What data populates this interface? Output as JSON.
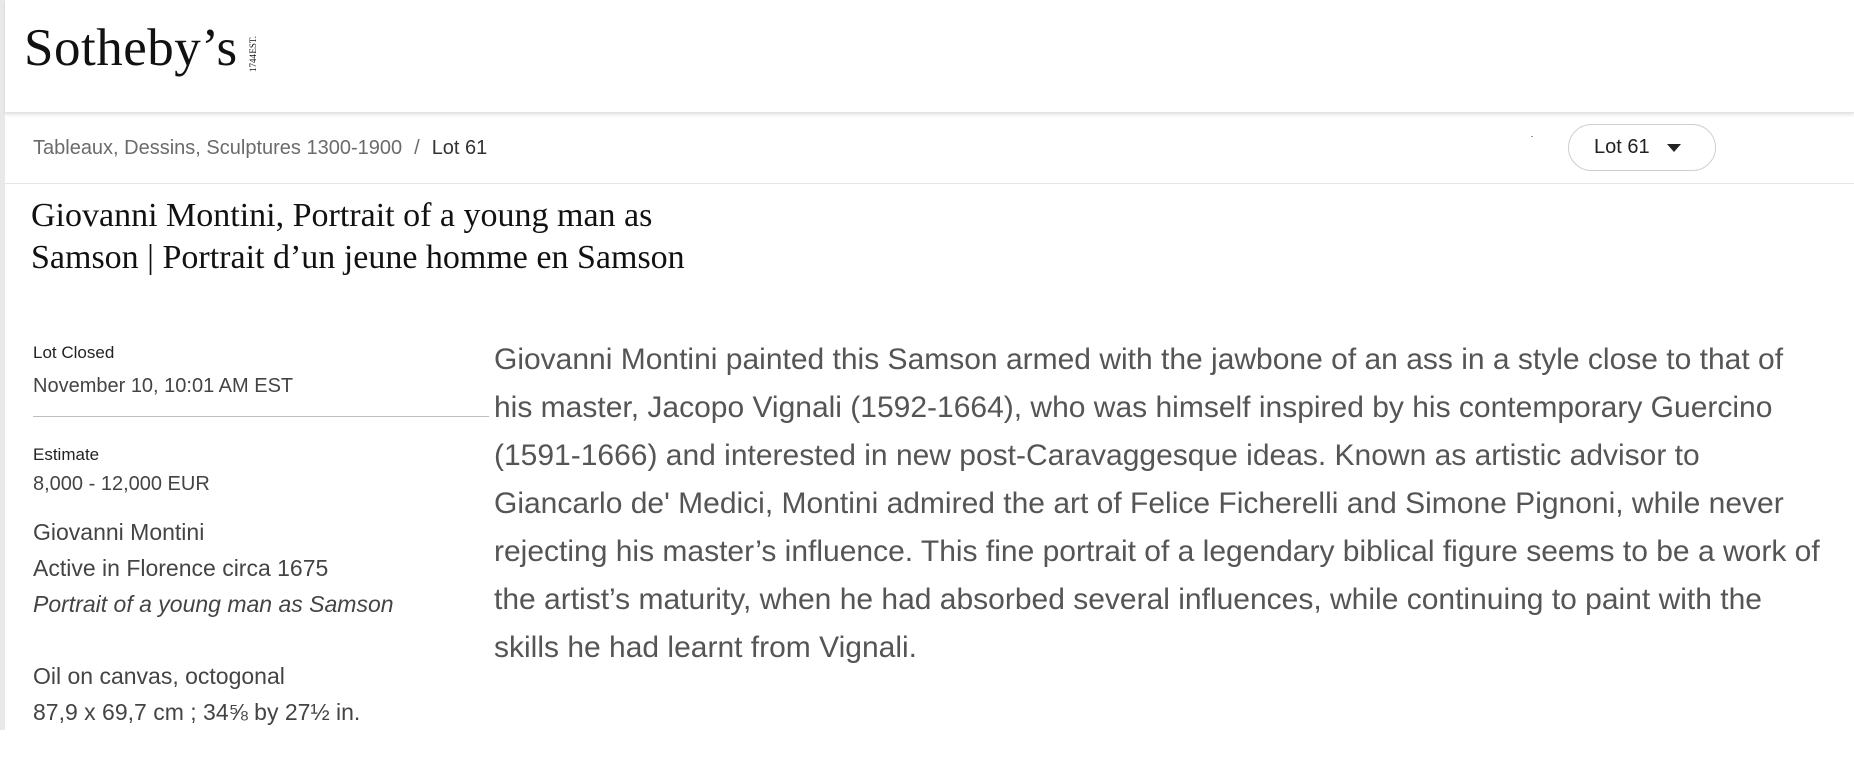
{
  "brand": {
    "name": "Sotheby’s",
    "est_label": "EST.",
    "est_year": "1744"
  },
  "breadcrumb": {
    "sale": "Tableaux, Dessins, Sculptures 1300-1900",
    "separator": "/",
    "current": "Lot 61"
  },
  "lot_selector": {
    "value": "Lot 61"
  },
  "lot": {
    "title": "Giovanni Montini, Portrait of a young man as Samson | Portrait d’un jeune homme en Samson",
    "status_label": "Lot Closed",
    "closed_time": "November 10, 10:01 AM EST",
    "estimate_label": "Estimate",
    "estimate_value": "8,000 - 12,000 EUR",
    "artist": "Giovanni Montini",
    "artist_note": "Active in Florence circa 1675",
    "work_title": "Portrait of a young man as Samson",
    "medium": "Oil on canvas, octogonal",
    "dimensions": "87,9 x 69,7 cm ; 34⅝ by 27½ in."
  },
  "essay": {
    "text": "Giovanni Montini painted this Samson armed with the jawbone of an ass in a style close to that of his master, Jacopo Vignali (1592-1664), who was himself inspired by his contemporary Guercino (1591-1666) and interested in new post-Caravaggesque ideas. Known as artistic advisor to Giancarlo de' Medici, Montini admired the art of Felice Ficherelli and Simone Pignoni, while never rejecting his master’s influence. This fine portrait of a legendary biblical figure seems to be a work of the artist’s maturity, when he had absorbed several influences, while continuing to paint with the skills he had learnt from Vignali."
  }
}
